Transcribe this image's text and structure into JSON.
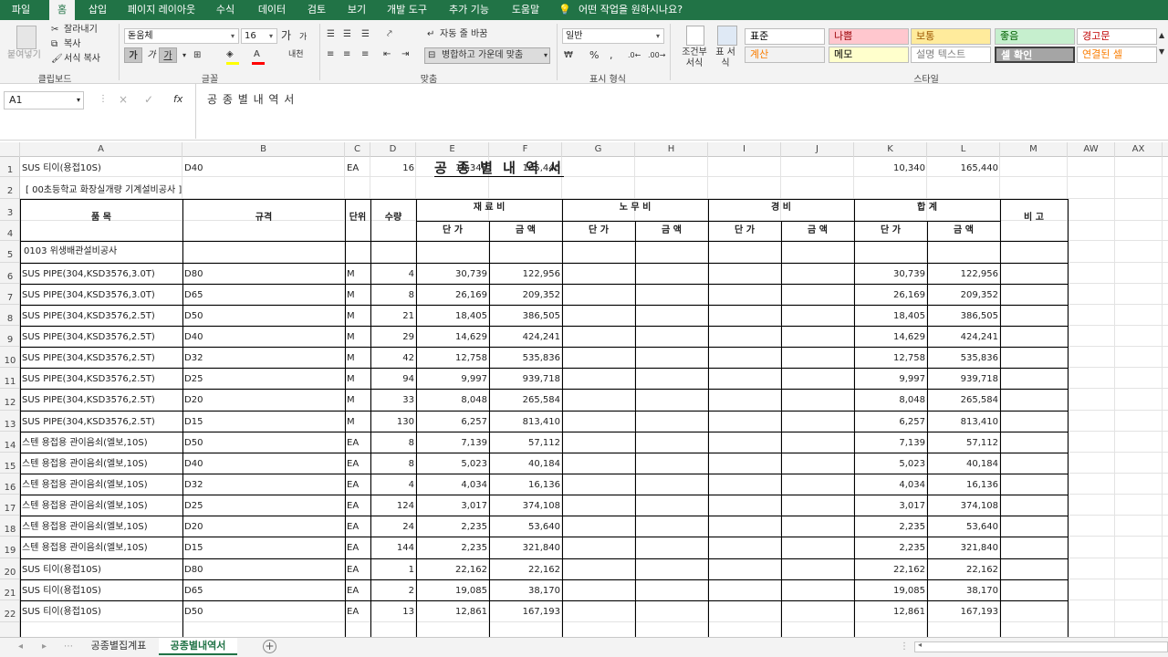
{
  "ribbon_tabs": [
    "파일",
    "홈",
    "삽입",
    "페이지 레이아웃",
    "수식",
    "데이터",
    "검토",
    "보기",
    "개발 도구",
    "추가 기능",
    "도움말"
  ],
  "tell_me": "어떤 작업을 원하시나요?",
  "clipboard": {
    "paste": "붙여넣기",
    "cut": "잘라내기",
    "copy": "복사",
    "format_painter": "서식 복사",
    "label": "클립보드"
  },
  "font": {
    "name": "돋움체",
    "size": "16",
    "grow": "가",
    "shrink": "가",
    "bold": "가",
    "italic": "가",
    "underline": "가",
    "phonetic": "내천",
    "label": "글꼴"
  },
  "alignment": {
    "wrap": "자동 줄 바꿈",
    "merge": "병합하고 가운데 맞춤",
    "label": "맞춤"
  },
  "number": {
    "format": "일반",
    "label": "표시 형식"
  },
  "styles": {
    "conditional": "조건부 서식",
    "table": "표 서식",
    "label": "스타일",
    "cells": [
      {
        "name": "표준",
        "bg": "#ffffff",
        "fg": "#000000"
      },
      {
        "name": "나쁨",
        "bg": "#ffc7ce",
        "fg": "#9c0006"
      },
      {
        "name": "보통",
        "bg": "#ffeb9c",
        "fg": "#9c5700"
      },
      {
        "name": "좋음",
        "bg": "#c6efce",
        "fg": "#006100"
      },
      {
        "name": "경고문",
        "bg": "#ffffff",
        "fg": "#c00000"
      },
      {
        "name": "계산",
        "bg": "#f2f2f2",
        "fg": "#fa7d00"
      },
      {
        "name": "메모",
        "bg": "#ffffcc",
        "fg": "#000000"
      },
      {
        "name": "설명 텍스트",
        "bg": "#ffffff",
        "fg": "#7f7f7f"
      },
      {
        "name": "셀 확인",
        "bg": "#a5a5a5",
        "fg": "#ffffff"
      },
      {
        "name": "연결된 셀",
        "bg": "#ffffff",
        "fg": "#fa7d00"
      }
    ]
  },
  "formula_bar": {
    "name_box": "A1",
    "cancel": "×",
    "confirm": "✓",
    "fx": "fx",
    "content": "공 종 별 내 역 서"
  },
  "columns": [
    "A",
    "B",
    "C",
    "D",
    "E",
    "F",
    "G",
    "H",
    "I",
    "J",
    "K",
    "L",
    "M",
    "AW",
    "AX"
  ],
  "rows": [
    "1",
    "2",
    "3",
    "4",
    "5",
    "6",
    "7",
    "8",
    "9",
    "10",
    "11",
    "12",
    "13",
    "14",
    "15",
    "16",
    "17",
    "18",
    "19",
    "20",
    "21",
    "22"
  ],
  "sheet": {
    "title": "공 종 별 내 역 서",
    "subtitle": "[ 00초등학교 화장실개량 기계설비공사 ]",
    "h_item": "품    목",
    "h_spec": "규격",
    "h_unit": "단위",
    "h_qty": "수량",
    "h_material": "재 료 비",
    "h_labor": "노 무 비",
    "h_expense": "경      비",
    "h_total": "합      계",
    "h_note": "비 고",
    "h_unitprice": "단 가",
    "h_amount": "금 액",
    "section": "0103 위생배관설비공사",
    "data": [
      [
        "SUS PIPE(304,KSD3576,3.0T)",
        "D80",
        "M",
        "4",
        "30,739",
        "122,956",
        "30,739",
        "122,956"
      ],
      [
        "SUS PIPE(304,KSD3576,3.0T)",
        "D65",
        "M",
        "8",
        "26,169",
        "209,352",
        "26,169",
        "209,352"
      ],
      [
        "SUS PIPE(304,KSD3576,2.5T)",
        "D50",
        "M",
        "21",
        "18,405",
        "386,505",
        "18,405",
        "386,505"
      ],
      [
        "SUS PIPE(304,KSD3576,2.5T)",
        "D40",
        "M",
        "29",
        "14,629",
        "424,241",
        "14,629",
        "424,241"
      ],
      [
        "SUS PIPE(304,KSD3576,2.5T)",
        "D32",
        "M",
        "42",
        "12,758",
        "535,836",
        "12,758",
        "535,836"
      ],
      [
        "SUS PIPE(304,KSD3576,2.5T)",
        "D25",
        "M",
        "94",
        "9,997",
        "939,718",
        "9,997",
        "939,718"
      ],
      [
        "SUS PIPE(304,KSD3576,2.5T)",
        "D20",
        "M",
        "33",
        "8,048",
        "265,584",
        "8,048",
        "265,584"
      ],
      [
        "SUS PIPE(304,KSD3576,2.5T)",
        "D15",
        "M",
        "130",
        "6,257",
        "813,410",
        "6,257",
        "813,410"
      ],
      [
        "스텐 용접용 관이음쇠(엘보,10S)",
        "D50",
        "EA",
        "8",
        "7,139",
        "57,112",
        "7,139",
        "57,112"
      ],
      [
        "스텐 용접용 관이음쇠(엘보,10S)",
        "D40",
        "EA",
        "8",
        "5,023",
        "40,184",
        "5,023",
        "40,184"
      ],
      [
        "스텐 용접용 관이음쇠(엘보,10S)",
        "D32",
        "EA",
        "4",
        "4,034",
        "16,136",
        "4,034",
        "16,136"
      ],
      [
        "스텐 용접용 관이음쇠(엘보,10S)",
        "D25",
        "EA",
        "124",
        "3,017",
        "374,108",
        "3,017",
        "374,108"
      ],
      [
        "스텐 용접용 관이음쇠(엘보,10S)",
        "D20",
        "EA",
        "24",
        "2,235",
        "53,640",
        "2,235",
        "53,640"
      ],
      [
        "스텐 용접용 관이음쇠(엘보,10S)",
        "D15",
        "EA",
        "144",
        "2,235",
        "321,840",
        "2,235",
        "321,840"
      ],
      [
        "SUS 티이(용접10S)",
        "D80",
        "EA",
        "1",
        "22,162",
        "22,162",
        "22,162",
        "22,162"
      ],
      [
        "SUS 티이(용접10S)",
        "D65",
        "EA",
        "2",
        "19,085",
        "38,170",
        "19,085",
        "38,170"
      ],
      [
        "SUS 티이(용접10S)",
        "D50",
        "EA",
        "13",
        "12,861",
        "167,193",
        "12,861",
        "167,193"
      ],
      [
        "SUS 티이(용접10S)",
        "D40",
        "EA",
        "16",
        "10,340",
        "165,440",
        "10,340",
        "165,440"
      ]
    ]
  },
  "sheet_tabs": [
    "공종별집계표",
    "공종별내역서"
  ],
  "add_sheet": "+"
}
